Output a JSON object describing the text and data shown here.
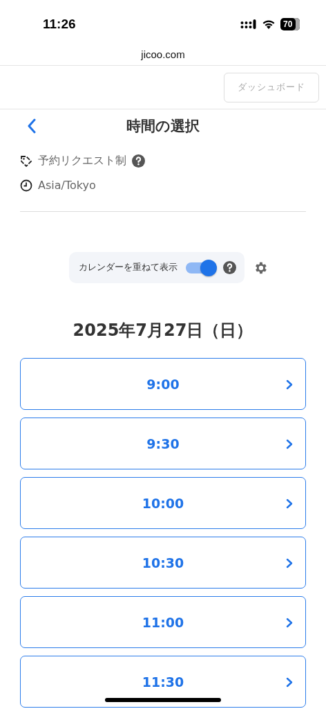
{
  "status_bar": {
    "time": "11:26",
    "battery": "70"
  },
  "browser": {
    "url": "jicoo.com"
  },
  "header": {
    "dashboard_button": "ダッシュボード"
  },
  "page": {
    "title": "時間の選択",
    "booking_type": "予約リクエスト制",
    "timezone": "Asia/Tokyo"
  },
  "calendar_overlay": {
    "label": "カレンダーを重ねて表示",
    "on": true
  },
  "date": "2025年7月27日（日）",
  "slots": [
    {
      "time": "9:00"
    },
    {
      "time": "9:30"
    },
    {
      "time": "10:00"
    },
    {
      "time": "10:30"
    },
    {
      "time": "11:00"
    },
    {
      "time": "11:30"
    }
  ]
}
